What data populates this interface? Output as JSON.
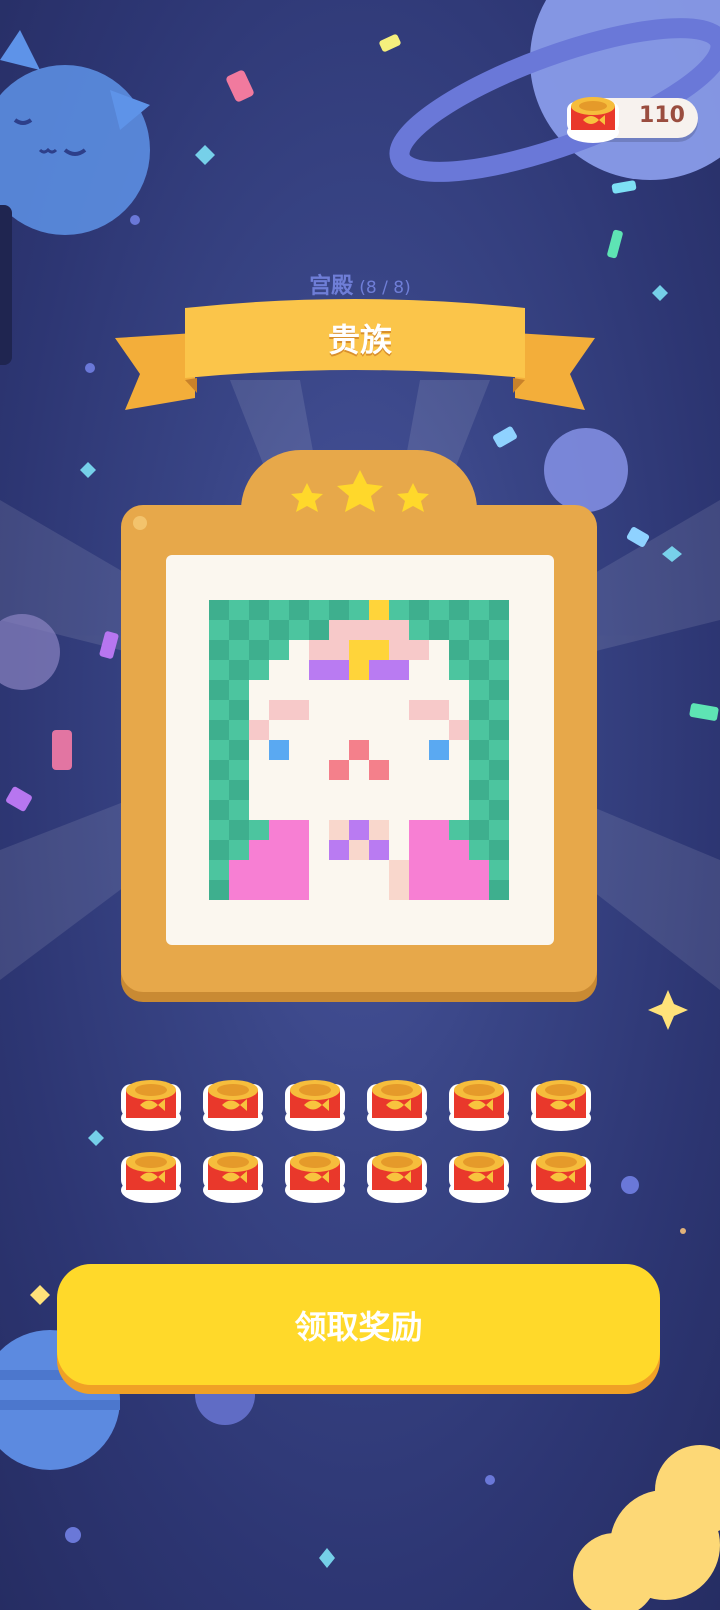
{
  "currency": {
    "icon": "fish-can-icon",
    "amount": "110"
  },
  "category": {
    "name": "宫殿",
    "progress": "(8 / 8)"
  },
  "title": "贵族",
  "stars": 3,
  "rewards": {
    "icon": "fish-can-icon",
    "count": 12
  },
  "claim_button": {
    "label": "领取奖励"
  },
  "colors": {
    "background": "#2d3673",
    "frame": "#e7a84a",
    "ribbon": "#fbc54a",
    "button": "#ffd92a",
    "pixel_bg": "#4cc59f",
    "pixel_bg_dark": "#3eaf8e"
  }
}
